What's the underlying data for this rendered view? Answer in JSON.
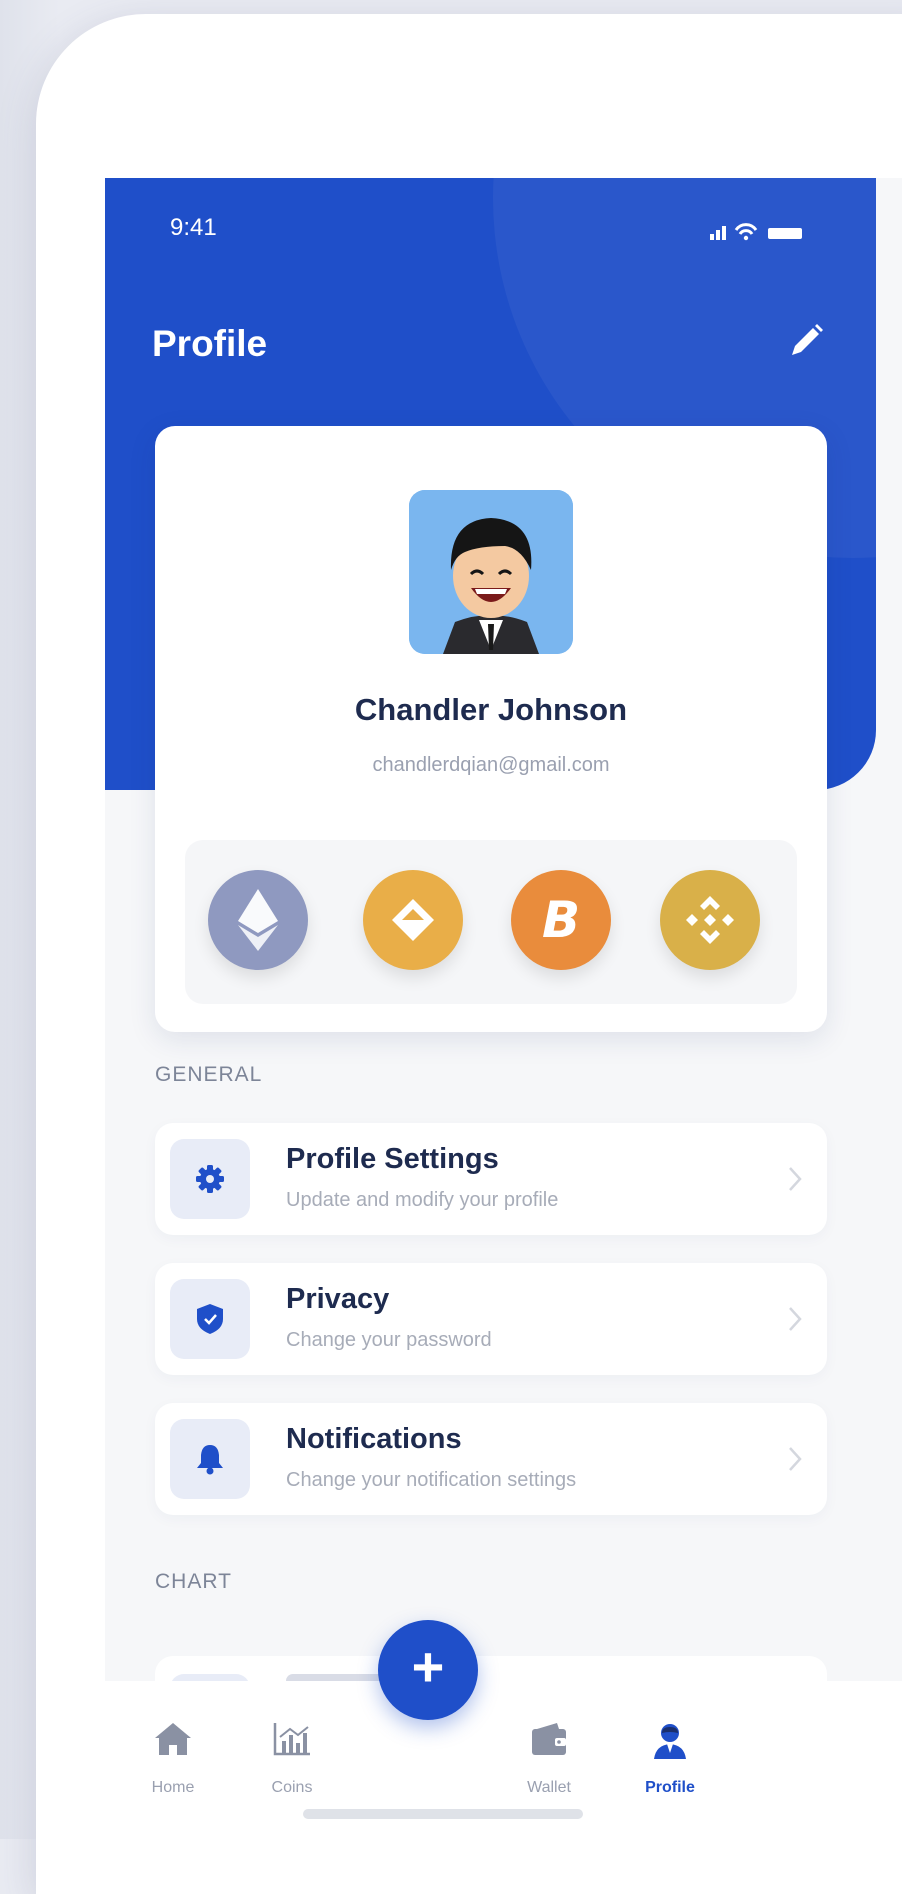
{
  "status_bar": {
    "time": "9:41"
  },
  "header": {
    "title": "Profile"
  },
  "profile": {
    "name": "Chandler Johnson",
    "email": "chandlerdqian@gmail.com"
  },
  "coins": [
    {
      "name": "ethereum",
      "color": "#8f99c0",
      "icon": "ethereum-icon"
    },
    {
      "name": "waves",
      "color": "#e9ae48",
      "icon": "waves-icon"
    },
    {
      "name": "bitcoin",
      "color": "#e98c3c",
      "icon": "bitcoin-icon",
      "symbol": "B"
    },
    {
      "name": "binance",
      "color": "#d9b049",
      "icon": "binance-icon"
    }
  ],
  "general": {
    "label": "GENERAL",
    "items": [
      {
        "title": "Profile Settings",
        "subtitle": "Update and modify your profile",
        "icon": "gear-icon"
      },
      {
        "title": "Privacy",
        "subtitle": "Change your password",
        "icon": "shield-icon"
      },
      {
        "title": "Notifications",
        "subtitle": "Change your notification settings",
        "icon": "bell-icon"
      }
    ]
  },
  "chart_section": {
    "label": "CHART"
  },
  "tabbar": {
    "tabs": [
      {
        "label": "Home",
        "icon": "home-icon"
      },
      {
        "label": "Coins",
        "icon": "chart-icon"
      },
      {
        "label": "Wallet",
        "icon": "wallet-icon"
      },
      {
        "label": "Profile",
        "icon": "user-icon",
        "active": true
      }
    ],
    "fab_symbol": "+"
  },
  "colors": {
    "primary": "#1f4fc9",
    "title_text": "#1e2b4f",
    "muted_text": "#a7acb8"
  }
}
